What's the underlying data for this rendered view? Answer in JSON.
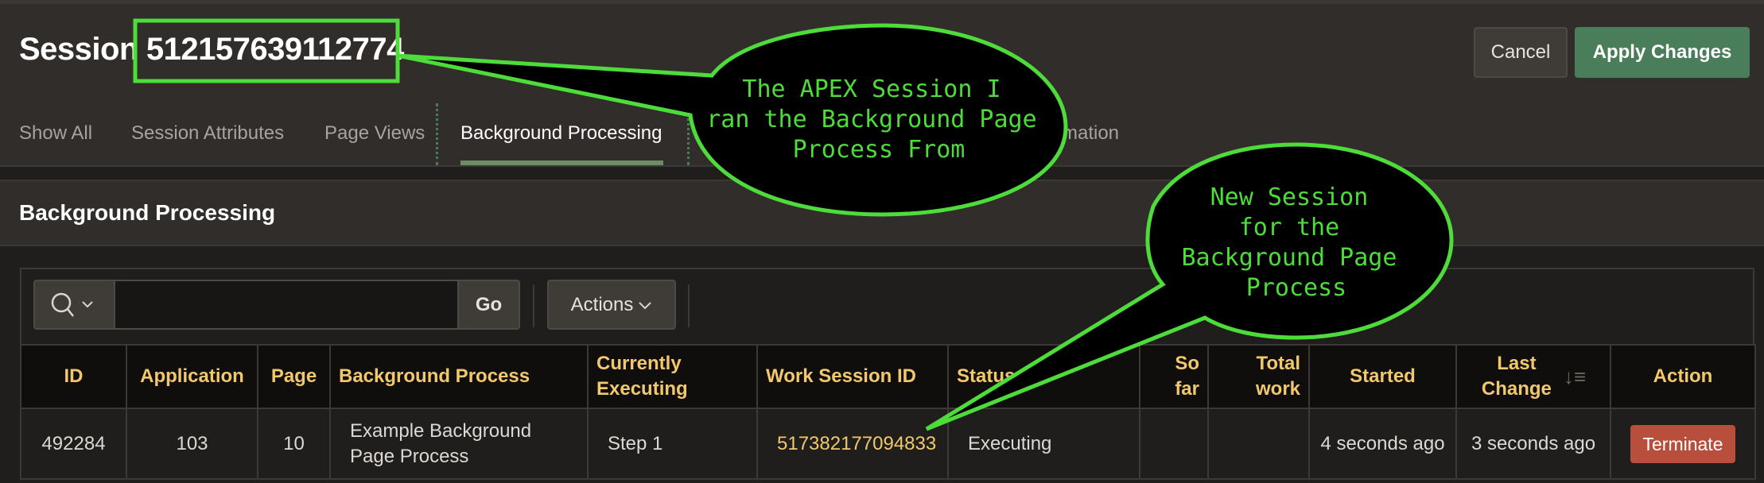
{
  "header": {
    "title_prefix": "Session",
    "session_id": "512157639112774",
    "cancel_label": "Cancel",
    "apply_label": "Apply Changes"
  },
  "tabs": [
    {
      "label": "Show All",
      "active": false
    },
    {
      "label": "Session Attributes",
      "active": false
    },
    {
      "label": "Page Views",
      "active": false
    },
    {
      "label": "Background Processing",
      "active": true
    },
    {
      "label": "rmation",
      "active": false
    }
  ],
  "region": {
    "title": "Background Processing",
    "search": {
      "value": "",
      "placeholder": "",
      "icon": "search-icon",
      "go_label": "Go"
    },
    "actions_label": "Actions"
  },
  "table": {
    "columns": [
      "ID",
      "Application",
      "Page",
      "Background Process",
      "Currently Executing",
      "Work Session ID",
      "Status",
      "So far",
      "Total work",
      "Started",
      "Last Change",
      "Action"
    ],
    "sorted_column": "Last Change",
    "rows": [
      {
        "id": "492284",
        "application": "103",
        "page": "10",
        "background_process": "Example Background Page Process",
        "currently_executing": "Step 1",
        "work_session_id": "517382177094833",
        "status": "Executing",
        "so_far": "",
        "total_work": "",
        "started": "4 seconds ago",
        "last_change": "3 seconds ago",
        "action_label": "Terminate"
      }
    ]
  },
  "annotations": [
    {
      "text_lines": [
        "The APEX Session I",
        "ran the Background Page",
        "Process From"
      ]
    },
    {
      "text_lines": [
        "New Session",
        "for the",
        "Background Page",
        "Process"
      ]
    }
  ],
  "colors": {
    "accent_green": "#4a7d5a",
    "header_text_gold": "#f2c86d",
    "terminate_red": "#b84f3d",
    "annotation_green": "#4ddc3a"
  }
}
